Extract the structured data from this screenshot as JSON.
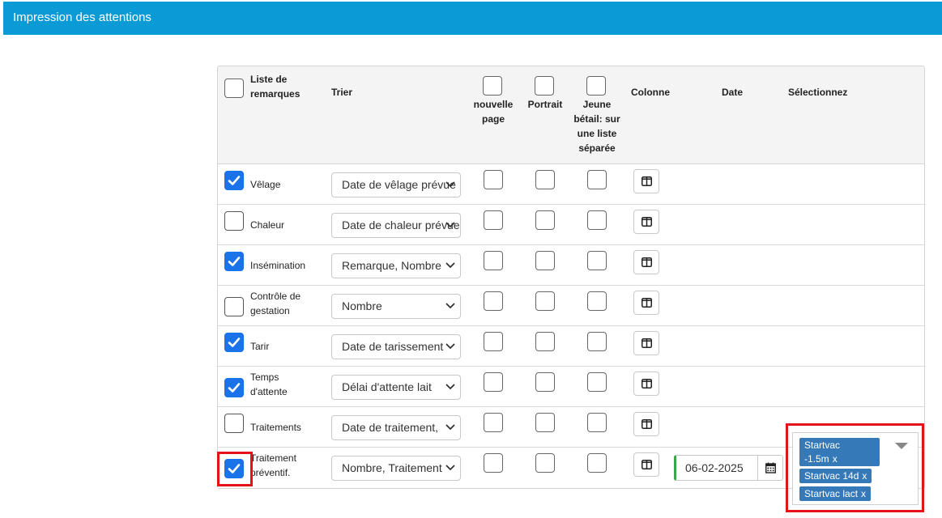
{
  "window": {
    "title": "Impression des attentions"
  },
  "header": {
    "list_label": "Liste de remarques",
    "sort_label": "Trier",
    "new_page_label": "nouvelle page",
    "portrait_label": "Portrait",
    "young_label": "Jeune bétail: sur une liste séparée",
    "column_label": "Colonne",
    "date_label": "Date",
    "select_label": "Sélectionnez"
  },
  "rows": [
    {
      "label": "Vêlage",
      "checked": true,
      "sort": "Date de vêlage prévue"
    },
    {
      "label": "Chaleur",
      "checked": false,
      "sort": "Date de chaleur prévue"
    },
    {
      "label": "Insémination",
      "checked": true,
      "sort": "Remarque, Nombre"
    },
    {
      "label": "Contrôle de gestation",
      "checked": false,
      "sort": "Nombre"
    },
    {
      "label": "Tarir",
      "checked": true,
      "sort": "Date de tarissement"
    },
    {
      "label": "Temps d'attente",
      "checked": true,
      "sort": "Délai d'attente lait"
    },
    {
      "label": "Traitements",
      "checked": false,
      "sort": "Date de traitement,"
    },
    {
      "label": "Traitement préventif.",
      "checked": true,
      "sort": "Nombre, Traitement",
      "date": "06-02-2025"
    }
  ],
  "selection": {
    "tags": [
      "Startvac -1.5m",
      "Startvac 14d",
      "Startvac lact"
    ],
    "remove_glyph": "x"
  },
  "colors": {
    "header_bar": "#0a9ad6",
    "checkbox_checked": "#1a73e8",
    "tag": "#3579b8",
    "date_valid": "#3aa645",
    "highlight": "#e3121b"
  }
}
